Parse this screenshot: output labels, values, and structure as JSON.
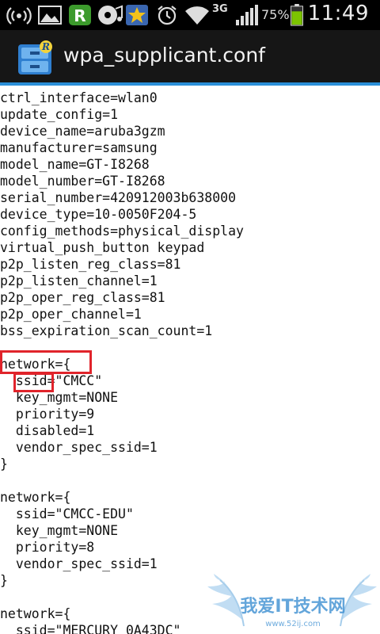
{
  "status_bar": {
    "network_type": "3G",
    "battery_percent": "75%",
    "time": "11:49",
    "icons": [
      "wifi-tethering-icon",
      "gallery-icon",
      "r-app-icon",
      "disc-icon",
      "star-app-icon",
      "alarm-icon",
      "wifi-icon",
      "signal-icon",
      "battery-icon"
    ]
  },
  "title_bar": {
    "title": "wpa_supplicant.conf",
    "icon": "file-cabinet-icon"
  },
  "file_lines": [
    "ctrl_interface=wlan0",
    "update_config=1",
    "device_name=aruba3gzm",
    "manufacturer=samsung",
    "model_name=GT-I8268",
    "model_number=GT-I8268",
    "serial_number=420912003b638000",
    "device_type=10-0050F204-5",
    "config_methods=physical_display",
    "virtual_push_button keypad",
    "p2p_listen_reg_class=81",
    "p2p_listen_channel=1",
    "p2p_oper_reg_class=81",
    "p2p_oper_channel=1",
    "bss_expiration_scan_count=1",
    "",
    "network={",
    "  ssid=\"CMCC\"",
    "  key_mgmt=NONE",
    "  priority=9",
    "  disabled=1",
    "  vendor_spec_ssid=1",
    "}",
    "",
    "network={",
    "  ssid=\"CMCC-EDU\"",
    "  key_mgmt=NONE",
    "  priority=8",
    "  vendor_spec_ssid=1",
    "}",
    "",
    "network={",
    "  ssid=\"MERCURY_0A43DC\""
  ],
  "watermark": {
    "text": "我爱IT技术网",
    "url_text": "www.52ij.com"
  },
  "colors": {
    "highlight_box": "#e0242b",
    "title_accent": "#2b8fd8",
    "battery": "#7cc400"
  }
}
